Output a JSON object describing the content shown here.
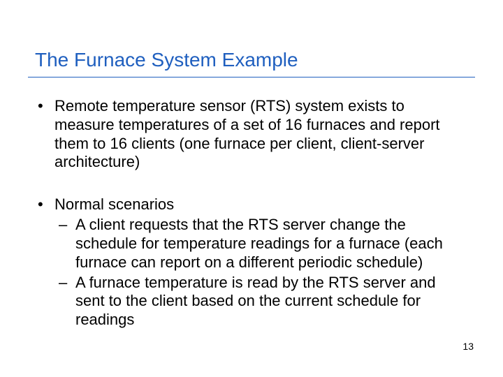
{
  "title": "The Furnace System Example",
  "bullets": {
    "b1": "Remote temperature sensor (RTS) system exists to measure temperatures of a set of 16 furnaces and report them to 16 clients (one furnace per client, client-server architecture)",
    "b2": {
      "text": "Normal scenarios",
      "sub": {
        "s1": "A client requests that the RTS server change the schedule for temperature readings for a furnace (each furnace can report on a different periodic schedule)",
        "s2": "A furnace temperature is read by the RTS server and sent to the client based on the current schedule for readings"
      }
    }
  },
  "page_number": "13"
}
